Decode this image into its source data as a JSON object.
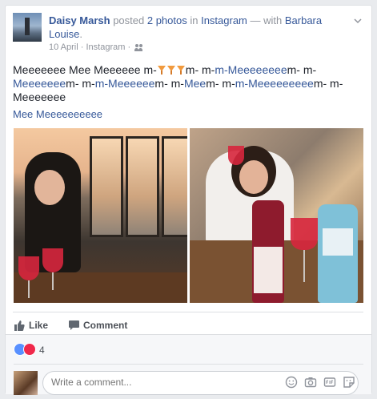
{
  "post": {
    "author": "Daisy Marsh",
    "verb_posted": " posted ",
    "photos_link": "2 photos",
    "in_text": " in ",
    "app_link": "Instagram",
    "with_text": " — with ",
    "tagged_first": "Barbara",
    "tagged_second": "Louise",
    "period": ".",
    "date": "10 April",
    "source": "Instagram",
    "separator": "·",
    "body": {
      "line1_a": "Meeeeeee Mee Meeeeee m-",
      "line1_b": "m- m-",
      "line1_link": "m-Meeeeeeee",
      "line1_c": "m- m-",
      "line2_link1": "Meeeeeee",
      "line2_a": "m- m-",
      "line2_link2": "m-Meeeeee",
      "line2_b": "m- m-",
      "line2_link3": "Mee",
      "line2_c": "m- m-",
      "line2_link4": "m-Meeeeeeeee",
      "line2_d": "m- m-",
      "line3": "Meeeeeee"
    },
    "see_more_link": "Mee Meeeeeeeeee",
    "actions": {
      "like": "Like",
      "comment": "Comment"
    },
    "reactions_count": "4",
    "comment_placeholder": "Write a comment..."
  },
  "icons": [
    "chevron-down-icon",
    "friends-icon",
    "drink-icon",
    "like-icon",
    "comment-icon",
    "like-reaction-icon",
    "love-reaction-icon",
    "emoji-icon",
    "camera-icon",
    "gif-icon",
    "sticker-icon"
  ],
  "colors": {
    "link": "#365899",
    "secondary_text": "#90949c",
    "background": "#e9ebee",
    "like_blue": "#5890ff",
    "love_red": "#f0284a"
  }
}
